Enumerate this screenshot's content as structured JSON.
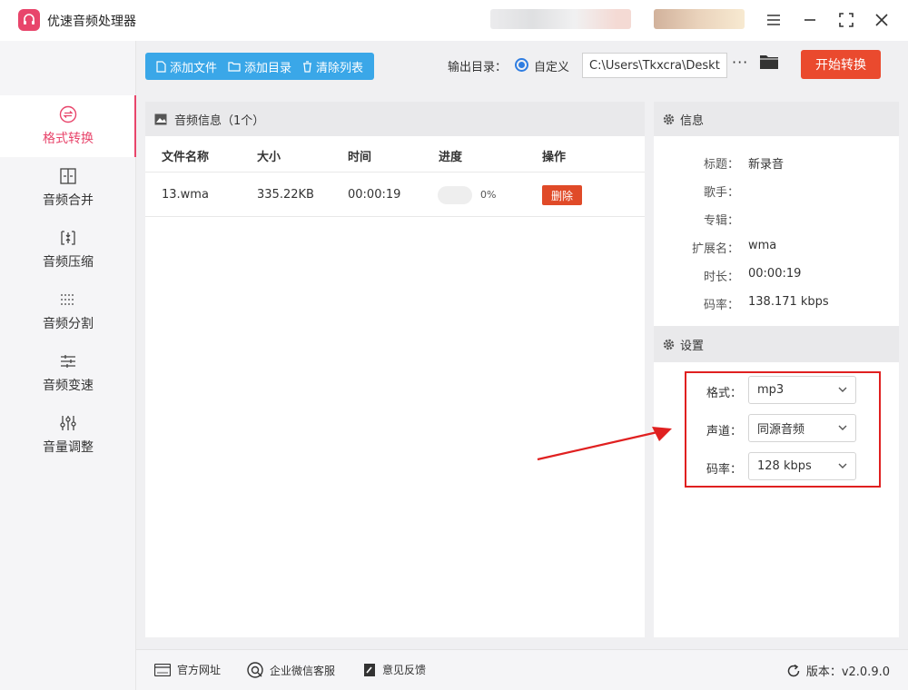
{
  "app": {
    "title": "优速音频处理器"
  },
  "sidebar": {
    "items": [
      {
        "label": "格式转换",
        "icon": "convert-icon",
        "active": true
      },
      {
        "label": "音频合并",
        "icon": "merge-icon"
      },
      {
        "label": "音频压缩",
        "icon": "compress-icon"
      },
      {
        "label": "音频分割",
        "icon": "split-icon"
      },
      {
        "label": "音频变速",
        "icon": "speed-icon"
      },
      {
        "label": "音量调整",
        "icon": "volume-icon"
      }
    ]
  },
  "toolbar": {
    "add_file": "添加文件",
    "add_folder": "添加目录",
    "clear_list": "清除列表",
    "output_label": "输出目录：",
    "output_mode": "自定义",
    "output_path": "C:\\Users\\Tkxcra\\Desktop",
    "more": "···",
    "start": "开始转换"
  },
  "file_panel": {
    "title": "音频信息（1个）",
    "columns": [
      "文件名称",
      "大小",
      "时间",
      "进度",
      "操作"
    ],
    "rows": [
      {
        "name": "13.wma",
        "size": "335.22KB",
        "time": "00:00:19",
        "progress": 0,
        "progress_text": "0%",
        "action": "删除"
      }
    ]
  },
  "info": {
    "title": "信息",
    "fields": [
      {
        "k": "标题：",
        "v": "新录音"
      },
      {
        "k": "歌手：",
        "v": ""
      },
      {
        "k": "专辑：",
        "v": ""
      },
      {
        "k": "扩展名：",
        "v": "wma"
      },
      {
        "k": "时长：",
        "v": "00:00:19"
      },
      {
        "k": "码率：",
        "v": "138.171 kbps"
      }
    ]
  },
  "settings": {
    "title": "设置",
    "format_label": "格式：",
    "format": "mp3",
    "channel_label": "声道：",
    "channel": "同源音频",
    "bitrate_label": "码率：",
    "bitrate": "128 kbps"
  },
  "footer": {
    "website": "官方网址",
    "wechat": "企业微信客服",
    "feedback": "意见反馈",
    "version": "版本：v2.0.9.0"
  },
  "colors": {
    "accent": "#e8456b",
    "primary": "#3aa7e8",
    "start": "#ea4a2e",
    "highlight": "#e02020"
  }
}
